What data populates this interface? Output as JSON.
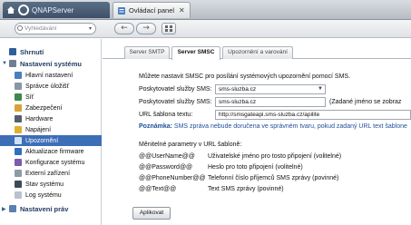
{
  "topbar": {
    "app_name": "QNAPServer",
    "panel_tab": "Ovládací panel"
  },
  "subbar": {
    "search_placeholder": "Vyhledávání"
  },
  "sidebar": {
    "section_system": "Nastavení systému",
    "summary": "Shrnutí",
    "items": [
      "Hlavní nastavení",
      "Správce úložišť",
      "Síť",
      "Zabezpečení",
      "Hardware",
      "Napájení",
      "Upozornění",
      "Aktualizace firmware",
      "Konfigurace systému",
      "Externí zařízení",
      "Stav systému",
      "Log systému"
    ],
    "section_privileges": "Nastavení práv",
    "active_item": "Upozornění"
  },
  "tabs": [
    "Server SMTP",
    "Server SMSC",
    "Upozornění a varování"
  ],
  "content": {
    "intro": "Můžete nastavit SMSC pro posílání systémových upozornění pomocí SMS.",
    "provider_label_1": "Poskytovatel služby SMS:",
    "provider_value_1": "sms-sluzba.cz",
    "provider_label_2": "Poskytovatel služby SMS:",
    "provider_value_2": "sms-sluzba.cz",
    "provider_hint": "(Zadané jméno se zobraz",
    "url_label": "URL šablona textu:",
    "url_value": "http://smsgateapi.sms-sluzba.cz/apilite",
    "note_label": "Poznámka:",
    "note_text": "SMS zpráva nebude doručena ve správném tvaru, pokud zadaný URL text šablone",
    "params_title": "Měnitelné parametry v URL šabloně:",
    "params": [
      {
        "key": "@@UserName@@",
        "desc": "Uživatelské jméno pro tosto připojení (volitelné)"
      },
      {
        "key": "@@Password@@",
        "desc": "Heslo pro toto připojení (volitelné)"
      },
      {
        "key": "@@PhoneNumber@@",
        "desc": "Telefonní číslo příjemců SMS zprávy (povinné)"
      },
      {
        "key": "@@Text@@",
        "desc": "Text SMS zprávy (povinné)"
      }
    ],
    "apply_button": "Aplikovat"
  },
  "colors": {
    "active_bg": "#3d6fb6",
    "note_color": "#1d4e9a",
    "topbar_dark": "#3e5067"
  }
}
